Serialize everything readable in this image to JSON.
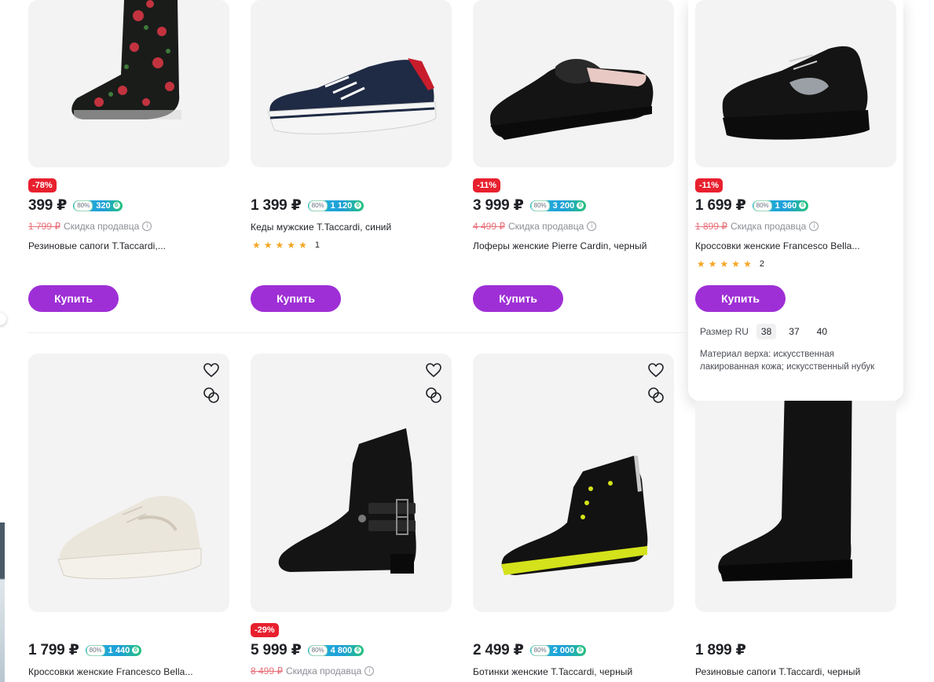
{
  "accent_color": "#9e2fd6",
  "discount_color": "#e8202e",
  "cards": [
    {
      "id": "c1",
      "price": "399 ₽",
      "bonus_pct": "80%",
      "bonus": "320",
      "badge": "-78%",
      "old_price": "1 799 ₽",
      "seller_discount": "Скидка продавца",
      "title": "Резиновые сапоги T.Taccardi,...",
      "buy": "Купить"
    },
    {
      "id": "c2",
      "price": "1 399 ₽",
      "bonus_pct": "80%",
      "bonus": "1 120",
      "title": "Кеды мужские T.Taccardi, синий",
      "rating": 5,
      "reviews": "1",
      "buy": "Купить"
    },
    {
      "id": "c3",
      "price": "3 999 ₽",
      "bonus_pct": "80%",
      "bonus": "3 200",
      "badge": "-11%",
      "old_price": "4 499 ₽",
      "seller_discount": "Скидка продавца",
      "title": "Лоферы женские Pierre Cardin, черный",
      "buy": "Купить"
    },
    {
      "id": "c4",
      "price": "1 699 ₽",
      "bonus_pct": "80%",
      "bonus": "1 360",
      "badge": "-11%",
      "old_price": "1 899 ₽",
      "seller_discount": "Скидка продавца",
      "title": "Кроссовки женские Francesco Bella...",
      "rating": 5,
      "reviews": "2",
      "buy": "Купить"
    },
    {
      "id": "c5",
      "price": "1 799 ₽",
      "bonus_pct": "80%",
      "bonus": "1 440",
      "title": "Кроссовки женские Francesco Bella..."
    },
    {
      "id": "c6",
      "price": "5 999 ₽",
      "bonus_pct": "80%",
      "bonus": "4 800",
      "badge": "-29%",
      "old_price": "8 499 ₽",
      "seller_discount": "Скидка продавца"
    },
    {
      "id": "c7",
      "price": "2 499 ₽",
      "bonus_pct": "80%",
      "bonus": "2 000",
      "title": "Ботинки женские T.Taccardi, черный"
    },
    {
      "id": "c8",
      "price": "1 899 ₽",
      "title": "Резиновые сапоги T.Taccardi, черный"
    }
  ],
  "popup": {
    "size_label": "Размер RU",
    "sizes": [
      "38",
      "37",
      "40"
    ],
    "material": "Материал верха: искусственная лакированная кожа; искусственный нубук"
  },
  "icons": {
    "favorite": "heart-icon",
    "compare": "compare-icon",
    "info": "info-icon",
    "star": "star-icon",
    "bonus": "bonus-coin-icon"
  }
}
